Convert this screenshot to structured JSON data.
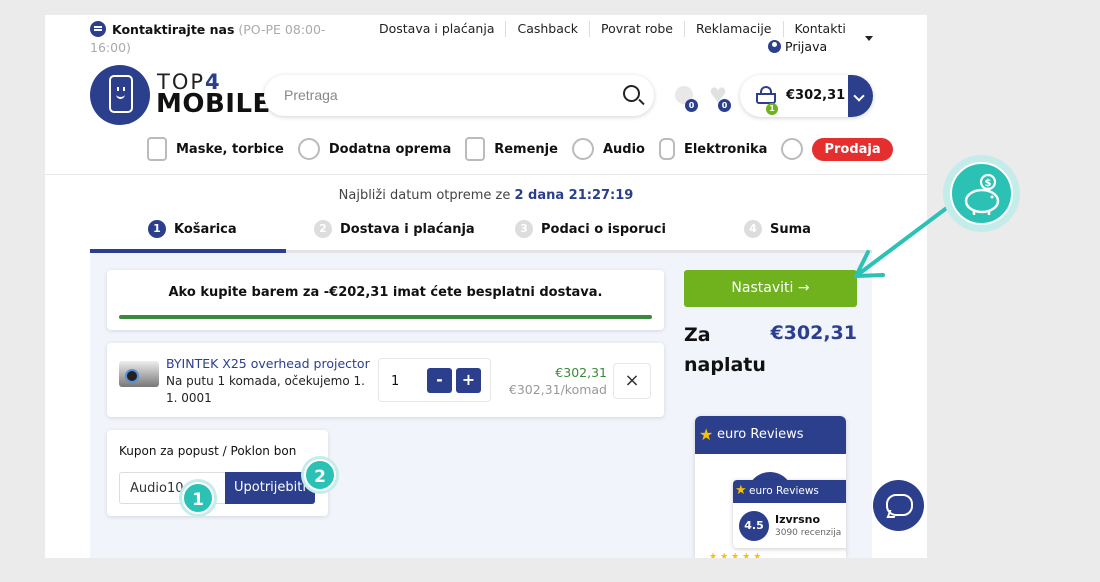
{
  "contact": {
    "label": "Kontaktirajte nas",
    "hours": "(PO-PE 08:00-16:00)"
  },
  "top_links": [
    "Dostava i plaćanja",
    "Cashback",
    "Povrat robe",
    "Reklamacije",
    "Kontakti"
  ],
  "login_label": "Prijava",
  "logo": {
    "top": "TOP",
    "four": "4",
    "mobile": "MOBILE"
  },
  "search": {
    "placeholder": "Pretraga"
  },
  "counters": {
    "compare": "0",
    "wishlist": "0"
  },
  "cart": {
    "total": "€302,31",
    "count": "1"
  },
  "categories": [
    {
      "label": "Maske, torbice",
      "icon": "phone-case-icon"
    },
    {
      "label": "Dodatna oprema",
      "icon": "charger-icon"
    },
    {
      "label": "Remenje",
      "icon": "strap-icon"
    },
    {
      "label": "Audio",
      "icon": "headphones-icon"
    },
    {
      "label": "Elektronika",
      "icon": "smartwatch-icon"
    }
  ],
  "sale_label": "Prodaja",
  "shipping": {
    "prefix": "Najbliži datum otpreme ze",
    "value": "2 dana 21:27:19"
  },
  "steps": [
    {
      "num": "1",
      "label": "Košarica"
    },
    {
      "num": "2",
      "label": "Dostava i plaćanja"
    },
    {
      "num": "3",
      "label": "Podaci o isporuci"
    },
    {
      "num": "4",
      "label": "Suma"
    }
  ],
  "free_shipping_msg": "Ako kupite barem za -€202,31 imat ćete besplatni dostava.",
  "free_shipping_progress": 1.0,
  "item": {
    "name": "BYINTEK X25 overhead projector",
    "note": "Na putu 1 komada, očekujemo 1. 1. 0001",
    "quantity": "1",
    "minus": "-",
    "plus": "+",
    "price": "€302,31",
    "unit_price": "€302,31/komad",
    "remove": "×"
  },
  "coupon": {
    "label": "Kupon za popust / Poklon bon",
    "value": "Audio10",
    "apply": "Upotrijebiti"
  },
  "markers": [
    "1",
    "2"
  ],
  "summary": {
    "proceed": "Nastaviti",
    "proceed_arrow": "→",
    "total_label": "Za naplatu",
    "total_value": "€302,31"
  },
  "reviews": {
    "brand": "euro Reviews",
    "score": "4.5",
    "rating_word": "Izvrsno",
    "count": "3090 recenzija",
    "stars": 4.5
  },
  "colors": {
    "brand_blue": "#2b3f8c",
    "accent_green": "#6fb21d",
    "sale_red": "#e52e2e",
    "marker_teal": "#2cc1b5",
    "review_star": "#f7c300"
  }
}
